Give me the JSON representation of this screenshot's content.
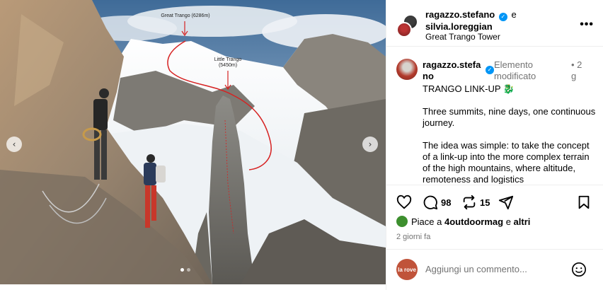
{
  "photo": {
    "labels": {
      "peak1_name": "Great Trango (6286m)",
      "peak2_name": "Little Trango",
      "peak2_height": "(5450m)"
    },
    "slide_count": 2,
    "active_slide": 1
  },
  "header": {
    "user1": "ragazzo.stefano",
    "conjunction": "e",
    "user2": "silvia.loreggian",
    "location": "Great Trango Tower",
    "more_label": "•••"
  },
  "caption": {
    "username": "ragazzo.stefano",
    "edited_label": "Elemento modificato",
    "time": "• 2 g",
    "title": "TRANGO LINK-UP",
    "title_emoji": "🐉",
    "paragraph1": "Three summits, nine days, one continuous journey.",
    "paragraph2": "The idea was simple: to take the concept of a link-up into the more complex terrain of the high mountains, where altitude, remoteness and logistics"
  },
  "actions": {
    "comment_count": "98",
    "repost_count": "15"
  },
  "likes": {
    "prefix": "Piace a",
    "user": "4outdoormag",
    "suffix": "e",
    "others": "altri"
  },
  "posted_ago": "2 giorni fa",
  "comment_box": {
    "avatar_text": "la rove",
    "placeholder": "Aggiungi un commento..."
  },
  "colors": {
    "verified": "#0095f6",
    "route_line": "#d62222"
  }
}
